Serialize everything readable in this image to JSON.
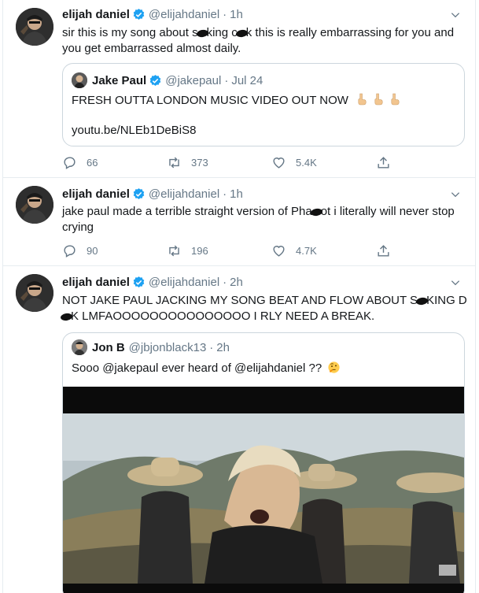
{
  "tweets": [
    {
      "author": "elijah daniel",
      "handle": "@elijahdaniel",
      "time": "1h",
      "text_a": "sir this is my song about s",
      "text_b": "king c",
      "text_c": "k this is really embarrassing for you and you get embarrassed almost daily.",
      "quote": {
        "author": "Jake Paul",
        "handle": "@jakepaul",
        "time": "Jul 24",
        "text": "FRESH OUTTA LONDON MUSIC VIDEO OUT NOW",
        "link": "youtu.be/NLEb1DeBiS8"
      },
      "replies": "66",
      "retweets": "373",
      "likes": "5.4K"
    },
    {
      "author": "elijah daniel",
      "handle": "@elijahdaniel",
      "time": "1h",
      "text_a": "jake paul made a terrible straight version of Pha",
      "text_b": "ot i literally will never stop crying",
      "replies": "90",
      "retweets": "196",
      "likes": "4.7K"
    },
    {
      "author": "elijah daniel",
      "handle": "@elijahdaniel",
      "time": "2h",
      "text_a": "NOT JAKE PAUL JACKING MY SONG BEAT AND FLOW ABOUT S",
      "text_b": "KING D",
      "text_c": "K LMFAOOOOOOOOOOOOOOO I RLY NEED A BREAK.",
      "quote": {
        "author": "Jon B",
        "handle": "@jbjonblack13",
        "time": "2h",
        "text": "Sooo @jakepaul ever heard of @elijahdaniel ??"
      }
    }
  ],
  "icons": {
    "verified": "verified-badge-icon",
    "reply": "reply-icon",
    "retweet": "retweet-icon",
    "like": "heart-icon",
    "share": "share-icon",
    "caret": "chevron-down-icon"
  },
  "colors": {
    "verified": "#1da1f2",
    "muted": "#657786",
    "border": "#e6ecf0",
    "quote_border": "#ccd6dd"
  }
}
